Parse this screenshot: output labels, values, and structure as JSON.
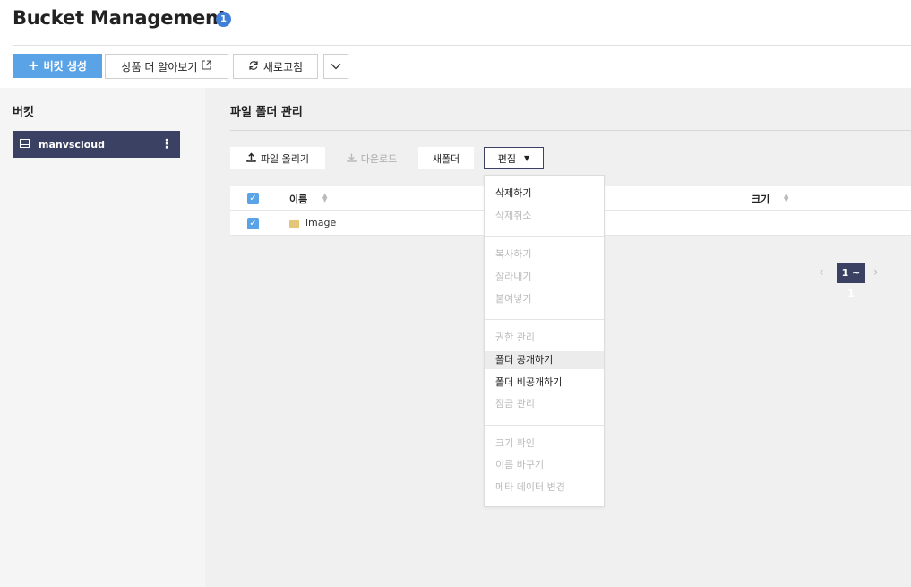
{
  "header": {
    "title": "Bucket Management",
    "badge": "1"
  },
  "toolbar": {
    "create_bucket": "버킷 생성",
    "learn_more": "상품 더 알아보기",
    "refresh": "새로고침"
  },
  "sidebar": {
    "heading": "버킷",
    "bucket_name": "manvscloud"
  },
  "main": {
    "heading": "파일 폴더 관리",
    "buttons": {
      "upload": "파일 올리기",
      "download": "다운로드",
      "new_folder": "새폴더",
      "edit": "편집"
    },
    "table": {
      "col_name": "이름",
      "col_size": "크기",
      "rows": [
        {
          "name": "image",
          "size": ""
        }
      ]
    },
    "pagination": {
      "current": "1 ~ 1"
    }
  },
  "edit_menu": {
    "items": [
      {
        "label": "삭제하기",
        "enabled": true
      },
      {
        "label": "삭제취소",
        "enabled": false
      },
      {
        "label": "복사하기",
        "enabled": false
      },
      {
        "label": "잘라내기",
        "enabled": false
      },
      {
        "label": "붙여넣기",
        "enabled": false
      },
      {
        "label": "권한 관리",
        "enabled": false
      },
      {
        "label": "폴더 공개하기",
        "enabled": true,
        "hover": true
      },
      {
        "label": "폴더 비공개하기",
        "enabled": true
      },
      {
        "label": "잠금 관리",
        "enabled": false
      },
      {
        "label": "크기 확인",
        "enabled": false
      },
      {
        "label": "이름 바꾸기",
        "enabled": false
      },
      {
        "label": "메타 데이터 변경",
        "enabled": false
      }
    ]
  },
  "colors": {
    "primary": "#5aa3e6",
    "navy": "#3a4163",
    "badge": "#3f7fd8",
    "folder": "#e3c678"
  }
}
